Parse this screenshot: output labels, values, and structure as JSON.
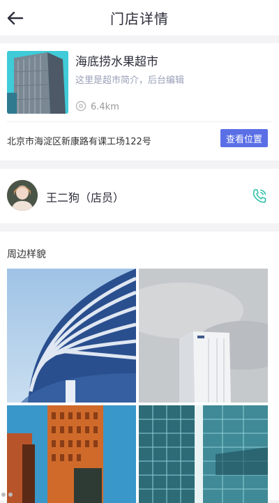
{
  "header": {
    "title": "门店详情",
    "back_icon": "arrow-left-icon"
  },
  "store": {
    "name": "海底捞水果超市",
    "description": "这里是超市简介，后台编辑",
    "distance": "6.4km",
    "address": "北京市海淀区新康路有课工场122号",
    "view_location_label": "查看位置"
  },
  "staff": {
    "name": "王二狗（店员）",
    "phone_icon": "phone-icon"
  },
  "gallery": {
    "title": "周边样貌"
  },
  "colors": {
    "accent": "#5a6fe6",
    "phone": "#2fc0a8",
    "title": "#2c2c3a",
    "muted": "#9aa0b8"
  }
}
